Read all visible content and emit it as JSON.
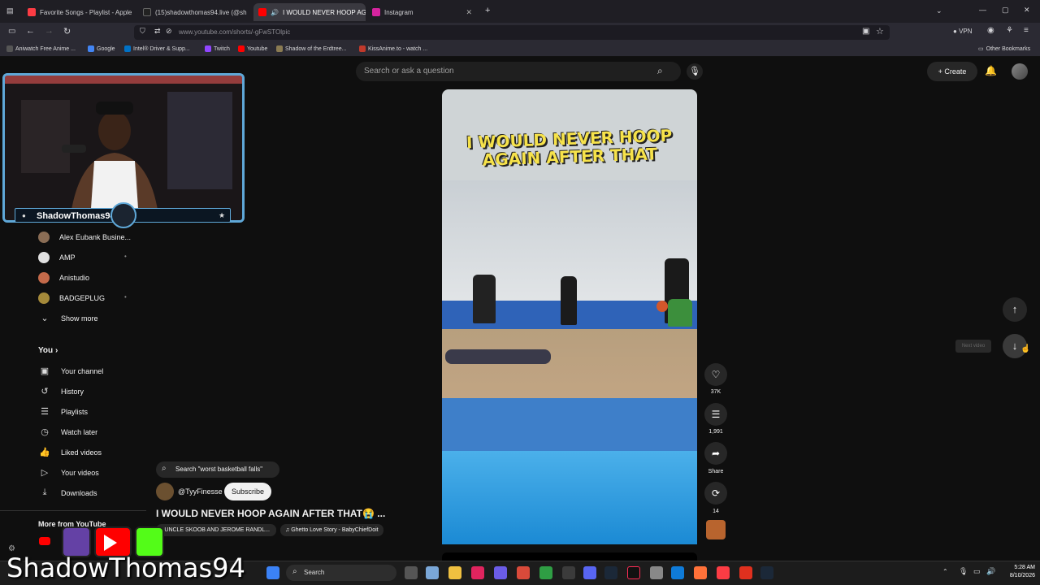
{
  "browser": {
    "tabs": [
      {
        "label": "Favorite Songs - Playlist - Apple",
        "color": "#fc3c44"
      },
      {
        "label": "(15)shadowthomas94.live (@sh",
        "color": "#222222"
      },
      {
        "label": "I WOULD NEVER HOOP AG",
        "color": "#ff0000"
      },
      {
        "label": "Instagram",
        "color": "#d6249f"
      }
    ],
    "new_tab": "+",
    "url": "www.youtube.com/shorts/-gFwSTOlpic",
    "vpn_label": "VPN",
    "bookmarks": [
      {
        "label": "Aniwatch Free Anime ...",
        "color": "#555"
      },
      {
        "label": "Google",
        "color": "#4285f4"
      },
      {
        "label": "Intel® Driver & Supp...",
        "color": "#0071c5"
      },
      {
        "label": "Twitch",
        "color": "#9146ff"
      },
      {
        "label": "Youtube",
        "color": "#ff0000"
      },
      {
        "label": "Shadow of the Erdtree...",
        "color": "#8a7b52"
      },
      {
        "label": "KissAnime.to - watch ...",
        "color": "#c0392b"
      }
    ],
    "other_bookmarks": "Other Bookmarks"
  },
  "youtube": {
    "logo": "YouTube",
    "search_placeholder": "Search or ask a question",
    "create_label": "+ Create",
    "subscriptions": [
      {
        "label": "Alex Eubank Busine...",
        "color": "#8a6d55",
        "dot": ""
      },
      {
        "label": "AMP",
        "color": "#e0e0e0",
        "dot": "•"
      },
      {
        "label": "Anistudio",
        "color": "#c46a4a",
        "dot": ""
      },
      {
        "label": "BADGEPLUG",
        "color": "#a58a3a",
        "dot": "•"
      }
    ],
    "show_more": "Show more",
    "you_heading": "You",
    "you_items": [
      {
        "label": "Your channel",
        "icon": "channel-icon",
        "glyph": "▣"
      },
      {
        "label": "History",
        "icon": "history-icon",
        "glyph": "↺"
      },
      {
        "label": "Playlists",
        "icon": "playlist-icon",
        "glyph": "☰"
      },
      {
        "label": "Watch later",
        "icon": "clock-icon",
        "glyph": "◷"
      },
      {
        "label": "Liked videos",
        "icon": "thumb-up-icon",
        "glyph": "👍"
      },
      {
        "label": "Your videos",
        "icon": "video-icon",
        "glyph": "▷"
      },
      {
        "label": "Downloads",
        "icon": "download-icon",
        "glyph": "⤓"
      }
    ],
    "more_heading": "More from YouTube"
  },
  "webcam": {
    "streamer_name": "ShadowThomas94"
  },
  "short": {
    "video_text": "I WOULD NEVER HOOP AGAIN AFTER THAT",
    "suggested_search": "Search \"worst basketball falls\"",
    "channel": "@TyyFinesse",
    "subscribe": "Subscribe",
    "title": "I WOULD NEVER HOOP AGAIN AFTER THAT😭 ...",
    "chips": [
      "• UNCLE SKOOB AND JEROME RANDL...",
      "♫ Ghetto Love Story - BabyChiefDoit"
    ],
    "actions": [
      {
        "name": "like",
        "glyph": "♡",
        "label": "37K"
      },
      {
        "name": "comment",
        "glyph": "☰",
        "label": "1,991"
      },
      {
        "name": "share",
        "glyph": "➦",
        "label": "Share"
      },
      {
        "name": "remix",
        "glyph": "⟳",
        "label": "14"
      }
    ]
  },
  "nav": {
    "up_glyph": "↑",
    "down_glyph": "↓",
    "next_tooltip": "Next video"
  },
  "overlay": {
    "watermark": "ShadowThomas94"
  },
  "taskbar": {
    "search": "Search",
    "time": "5:28 AM",
    "date": "8/10/2026"
  }
}
